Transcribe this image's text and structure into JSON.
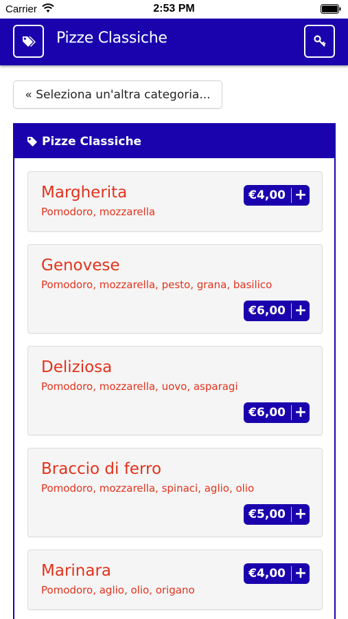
{
  "status_bar": {
    "carrier": "Carrier",
    "time": "2:53 PM"
  },
  "navbar": {
    "title": "Pizze Classiche",
    "left_icon": "tags-icon",
    "right_icon": "key-icon"
  },
  "back_button": {
    "label": "« Seleziona un'altra categoria..."
  },
  "panel": {
    "title": "Pizze Classiche"
  },
  "items": [
    {
      "name": "Margherita",
      "description": "Pomodoro, mozzarella",
      "price": "€4,00",
      "add_label": "+"
    },
    {
      "name": "Genovese",
      "description": "Pomodoro, mozzarella, pesto, grana, basilico",
      "price": "€6,00",
      "add_label": "+"
    },
    {
      "name": "Deliziosa",
      "description": "Pomodoro, mozzarella, uovo, asparagi",
      "price": "€6,00",
      "add_label": "+"
    },
    {
      "name": "Braccio di ferro",
      "description": "Pomodoro, mozzarella, spinaci, aglio, olio",
      "price": "€5,00",
      "add_label": "+"
    },
    {
      "name": "Marinara",
      "description": "Pomodoro, aglio, olio, origano",
      "price": "€4,00",
      "add_label": "+"
    }
  ],
  "colors": {
    "brand": "#1a03ad",
    "item_text": "#e3321c",
    "item_bg": "#f5f5f5"
  }
}
